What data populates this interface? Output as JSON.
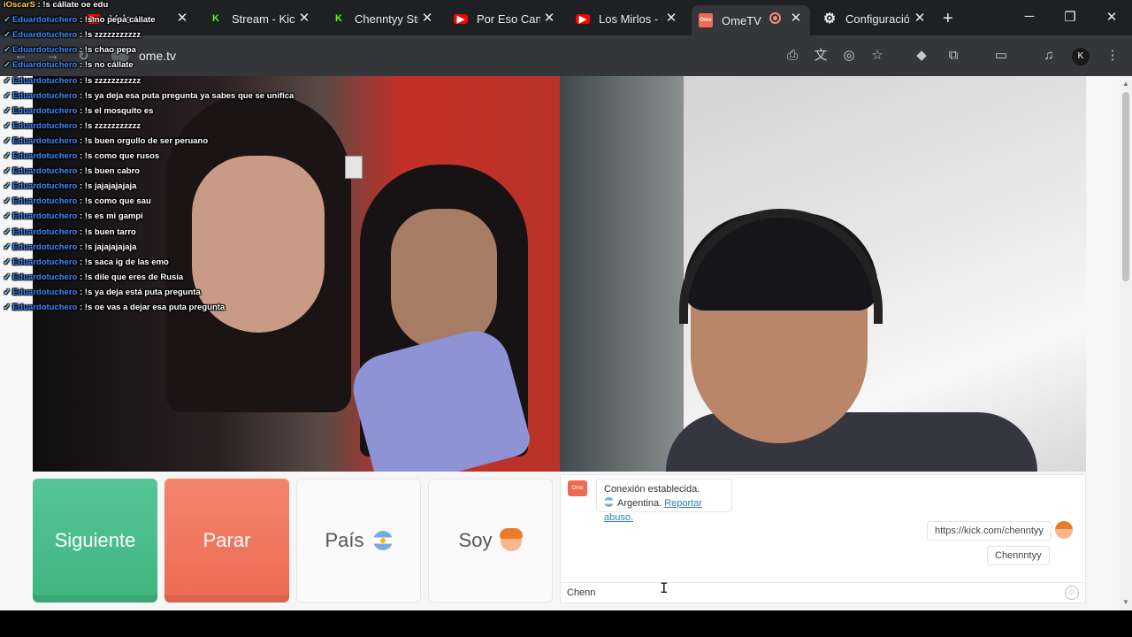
{
  "tabs": [
    {
      "label": "Valencc",
      "icon": "youtube-icon"
    },
    {
      "label": "Stream - Kick",
      "icon": "kick-icon"
    },
    {
      "label": "Chenntyy Stream",
      "icon": "kick-icon"
    },
    {
      "label": "Por Eso Canto",
      "icon": "youtube-icon"
    },
    {
      "label": "Los Mirlos - I",
      "icon": "youtube-icon"
    },
    {
      "label": "OmeTV Video",
      "icon": "ometv-icon",
      "active": true
    },
    {
      "label": "Configuración",
      "icon": "gear-icon"
    }
  ],
  "address": {
    "url": "ome.tv"
  },
  "controls": {
    "next_label": "Siguiente",
    "stop_label": "Parar",
    "country_label": "País",
    "gender_label": "Soy"
  },
  "chat": {
    "system_connected": "Conexión establecida.",
    "system_country": "Argentina.",
    "report_abuse": "Reportar abuso.",
    "messages": [
      {
        "text": "https://kick.com/chenntyy"
      },
      {
        "text": "Chennntyy"
      }
    ],
    "input_value": "Chenn"
  },
  "overlay": {
    "lines": [
      {
        "user": "iOscarS",
        "sep": " : ",
        "text": "!s cállate oe edu"
      },
      {
        "user": "Eduardotuchero",
        "sep": " : ",
        "text": "!s no pepa cállate"
      },
      {
        "user": "Eduardotuchero",
        "sep": " : ",
        "text": "!s zzzzzzzzzzz"
      },
      {
        "user": "Eduardotuchero",
        "sep": " : ",
        "text": "!s chao pepa"
      },
      {
        "user": "Eduardotuchero",
        "sep": " : ",
        "text": "!s no cállate"
      },
      {
        "user": "Eduardotuchero",
        "sep": " : ",
        "text": "!s zzzzzzzzzzz"
      },
      {
        "user": "Eduardotuchero",
        "sep": " : ",
        "text": "!s ya deja esa puta pregunta ya sabes que se unifica"
      },
      {
        "user": "Eduardotuchero",
        "sep": " : ",
        "text": "!s el mosquito es"
      },
      {
        "user": "Eduardotuchero",
        "sep": " : ",
        "text": "!s zzzzzzzzzzz"
      },
      {
        "user": "Eduardotuchero",
        "sep": " : ",
        "text": "!s buen orgullo de ser peruano"
      },
      {
        "user": "Eduardotuchero",
        "sep": " : ",
        "text": "!s como que rusos"
      },
      {
        "user": "Eduardotuchero",
        "sep": " : ",
        "text": "!s buen cabro"
      },
      {
        "user": "Eduardotuchero",
        "sep": " : ",
        "text": "!s jajajajajaja"
      },
      {
        "user": "Eduardotuchero",
        "sep": " : ",
        "text": "!s como que sau"
      },
      {
        "user": "Eduardotuchero",
        "sep": " : ",
        "text": "!s es mi gampi"
      },
      {
        "user": "Eduardotuchero",
        "sep": " : ",
        "text": "!s buen tarro"
      },
      {
        "user": "Eduardotuchero",
        "sep": " : ",
        "text": "!s jajajajajaja"
      },
      {
        "user": "Eduardotuchero",
        "sep": " : ",
        "text": "!s saca ig de las emo"
      },
      {
        "user": "Eduardotuchero",
        "sep": " : ",
        "text": "!s dile que eres de Rusia"
      },
      {
        "user": "Eduardotuchero",
        "sep": " : ",
        "text": "!s ya deja está puta pregunta"
      },
      {
        "user": "Eduardotuchero",
        "sep": " : ",
        "text": "!s oe vas a dejar esa puta pregunta"
      }
    ]
  },
  "colors": {
    "next_button": "#3fb57f",
    "stop_button": "#ec6b52",
    "link": "#2f7fb8",
    "overlay_user": "#3d8bff"
  }
}
